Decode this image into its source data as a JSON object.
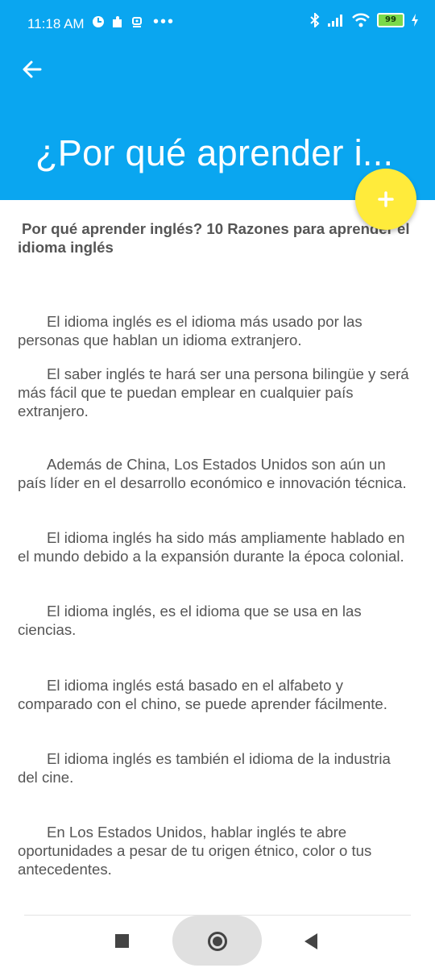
{
  "status_bar": {
    "time": "11:18 AM",
    "dots": "•••",
    "battery_level": "99",
    "icons": [
      "clock-circle-icon",
      "puzzle-icon",
      "robot-icon",
      "bluetooth-icon",
      "signal-icon",
      "wifi-icon",
      "battery-icon",
      "charging-icon"
    ]
  },
  "header": {
    "title": "¿Por qué aprender i...",
    "back_icon": "arrow-back-icon",
    "accent_color": "#0aa6f0"
  },
  "fab": {
    "icon": "plus-icon",
    "color": "#ffeb3b"
  },
  "article": {
    "heading_line1": "Por qué aprender inglés? 10 Razones para aprender el",
    "heading_line2": "idioma inglés",
    "paragraphs": [
      "El idioma inglés es el idioma más usado por las personas que hablan un idioma extranjero.",
      "El saber inglés te hará ser una persona bilingüe y será más fácil que te puedan emplear en cualquier país extranjero.",
      "Además de China, Los Estados Unidos son aún un país líder en el desarrollo económico e innovación técnica.",
      "El idioma inglés ha sido más ampliamente hablado en el mundo debido a la expansión durante la época colonial.",
      "El idioma inglés, es el idioma que se usa en las ciencias.",
      "El idioma inglés está basado en el alfabeto y comparado con el chino, se puede aprender fácilmente.",
      "El idioma inglés es también el idioma de la industria del cine.",
      "En Los Estados Unidos, hablar inglés te abre oportunidades a pesar de tu origen étnico, color o tus antecedentes."
    ]
  },
  "nav_bar": {
    "icons": [
      "recent-apps-icon",
      "home-icon",
      "back-icon"
    ]
  }
}
